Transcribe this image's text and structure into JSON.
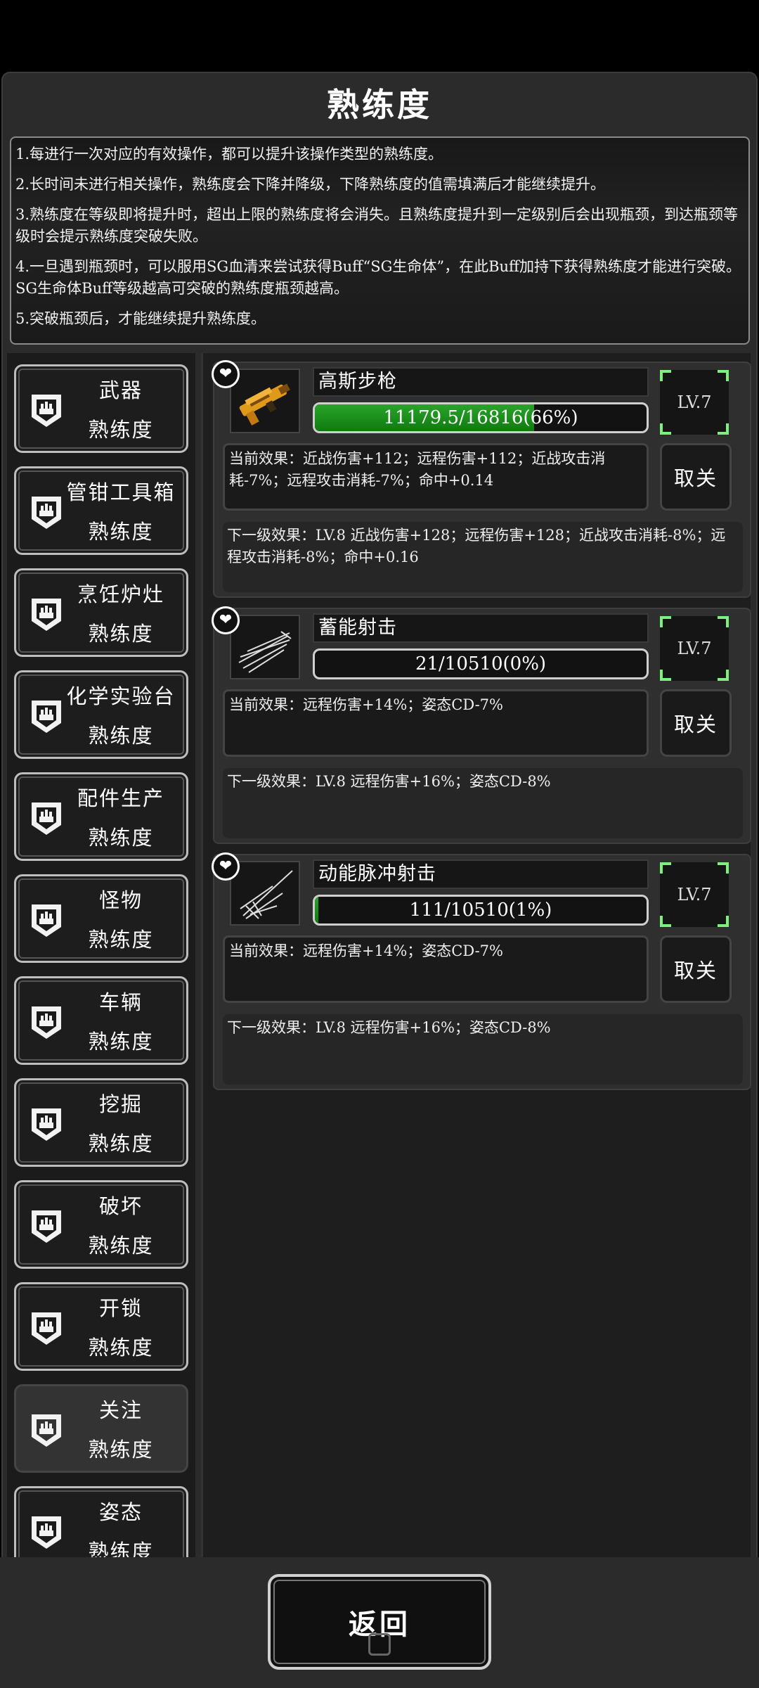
{
  "title": "熟练度",
  "rules": [
    "1.每进行一次对应的有效操作，都可以提升该操作类型的熟练度。",
    "2.长时间未进行相关操作，熟练度会下降并降级，下降熟练度的值需填满后才能继续提升。",
    "3.熟练度在等级即将提升时，超出上限的熟练度将会消失。且熟练度提升到一定级别后会出现瓶颈，到达瓶颈等级时会提示熟练度突破失败。",
    "4.一旦遇到瓶颈时，可以服用SG血清来尝试获得Buff“SG生命体”，在此Buff加持下获得熟练度才能进行突破。SG生命体Buff等级越高可突破的熟练度瓶颈越高。",
    "5.突破瓶颈后，才能继续提升熟练度。"
  ],
  "sidebar": {
    "suffix": "熟练度",
    "items": [
      {
        "label": "武器"
      },
      {
        "label": "管钳工具箱"
      },
      {
        "label": "烹饪炉灶"
      },
      {
        "label": "化学实验台"
      },
      {
        "label": "配件生产"
      },
      {
        "label": "怪物"
      },
      {
        "label": "车辆"
      },
      {
        "label": "挖掘"
      },
      {
        "label": "破坏"
      },
      {
        "label": "开锁"
      },
      {
        "label": "关注",
        "active": true
      },
      {
        "label": "姿态"
      }
    ]
  },
  "skills": [
    {
      "name": "高斯步枪",
      "icon": "gauss-rifle-icon",
      "progress_text": "11179.5/16816(66%)",
      "progress": 0.66,
      "level": "LV.7",
      "current_effect": "当前效果：近战伤害+112；远程伤害+112；近战攻击消耗-7%；远程攻击消耗-7%；命中+0.14",
      "cancel_label": "取关",
      "next_effect": "下一级效果：LV.8 近战伤害+128；远程伤害+128；近战攻击消耗-8%；远程攻击消耗-8%；命中+0.16"
    },
    {
      "name": "蓄能射击",
      "icon": "charged-shot-icon",
      "progress_text": "21/10510(0%)",
      "progress": 0.0,
      "level": "LV.7",
      "current_effect": "当前效果：远程伤害+14%；姿态CD-7%",
      "cancel_label": "取关",
      "next_effect": "下一级效果：LV.8 远程伤害+16%；姿态CD-8%"
    },
    {
      "name": "动能脉冲射击",
      "icon": "pulse-shot-icon",
      "progress_text": "111/10510(1%)",
      "progress": 0.01,
      "level": "LV.7",
      "current_effect": "当前效果：远程伤害+14%；姿态CD-7%",
      "cancel_label": "取关",
      "next_effect": "下一级效果：LV.8 远程伤害+16%；姿态CD-8%"
    }
  ],
  "back_label": "返回"
}
